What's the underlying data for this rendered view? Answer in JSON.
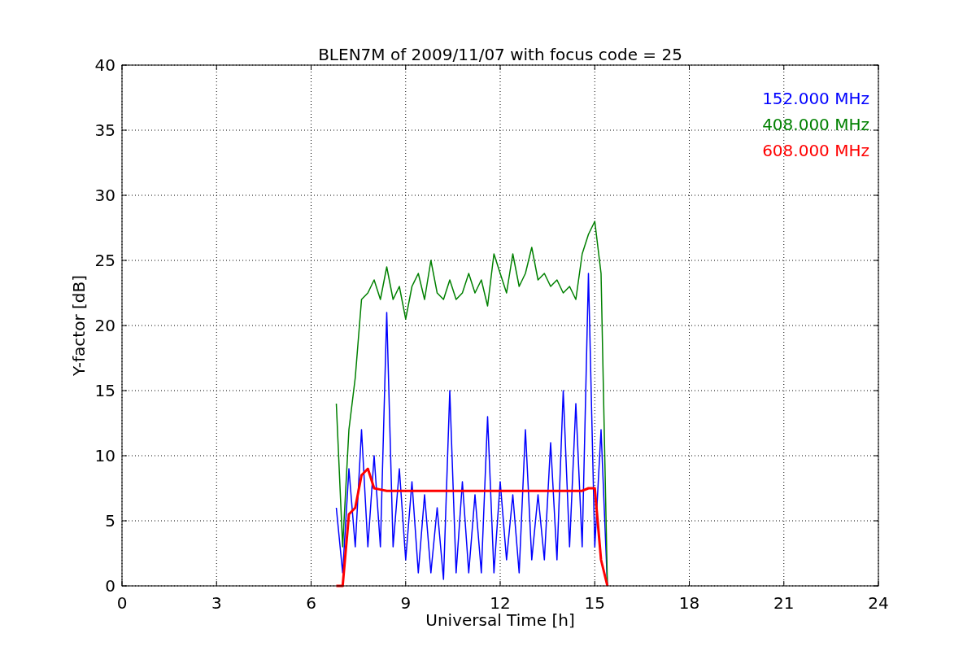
{
  "chart_data": {
    "type": "line",
    "title": "BLEN7M of 2009/11/07 with focus code = 25",
    "xlabel": "Universal Time [h]",
    "ylabel": "Y-factor [dB]",
    "grid": true,
    "xlim": [
      0,
      24
    ],
    "ylim": [
      0,
      40
    ],
    "xticks": [
      0,
      3,
      6,
      9,
      12,
      15,
      18,
      21,
      24
    ],
    "yticks": [
      0,
      5,
      10,
      15,
      20,
      25,
      30,
      35,
      40
    ],
    "x": [
      6.8,
      7.0,
      7.2,
      7.4,
      7.6,
      7.8,
      8.0,
      8.2,
      8.4,
      8.6,
      8.8,
      9.0,
      9.2,
      9.4,
      9.6,
      9.8,
      10.0,
      10.2,
      10.4,
      10.6,
      10.8,
      11.0,
      11.2,
      11.4,
      11.6,
      11.8,
      12.0,
      12.2,
      12.4,
      12.6,
      12.8,
      13.0,
      13.2,
      13.4,
      13.6,
      13.8,
      14.0,
      14.2,
      14.4,
      14.6,
      14.8,
      15.0,
      15.2,
      15.4
    ],
    "series": [
      {
        "name": "152.000 MHz",
        "color": "#0000ff",
        "values": [
          6,
          1,
          9,
          3,
          12,
          3,
          10,
          3,
          21,
          3,
          9,
          2,
          8,
          1,
          7,
          1,
          6,
          0.5,
          15,
          1,
          8,
          1,
          7,
          1,
          13,
          1,
          8,
          2,
          7,
          1,
          12,
          2,
          7,
          2,
          11,
          2,
          15,
          3,
          14,
          3,
          24,
          3,
          12,
          0
        ]
      },
      {
        "name": "408.000 MHz",
        "color": "#008000",
        "values": [
          14,
          3,
          12,
          16,
          22,
          22.5,
          23.5,
          22,
          24.5,
          22,
          23,
          20.5,
          23,
          24,
          22,
          25,
          22.5,
          22,
          23.5,
          22,
          22.5,
          24,
          22.5,
          23.5,
          21.5,
          25.5,
          24,
          22.5,
          25.5,
          23,
          24,
          26,
          23.5,
          24,
          23,
          23.5,
          22.5,
          23,
          22,
          25.5,
          27,
          28,
          24,
          0
        ]
      },
      {
        "name": "608.000 MHz",
        "color": "#ff0000",
        "values": [
          0,
          0,
          5.5,
          6,
          8.5,
          9,
          7.5,
          7.4,
          7.3,
          7.3,
          7.3,
          7.3,
          7.3,
          7.3,
          7.3,
          7.3,
          7.3,
          7.3,
          7.3,
          7.3,
          7.3,
          7.3,
          7.3,
          7.3,
          7.3,
          7.3,
          7.3,
          7.3,
          7.3,
          7.3,
          7.3,
          7.3,
          7.3,
          7.3,
          7.3,
          7.3,
          7.3,
          7.3,
          7.3,
          7.3,
          7.5,
          7.5,
          2,
          0
        ]
      }
    ]
  }
}
